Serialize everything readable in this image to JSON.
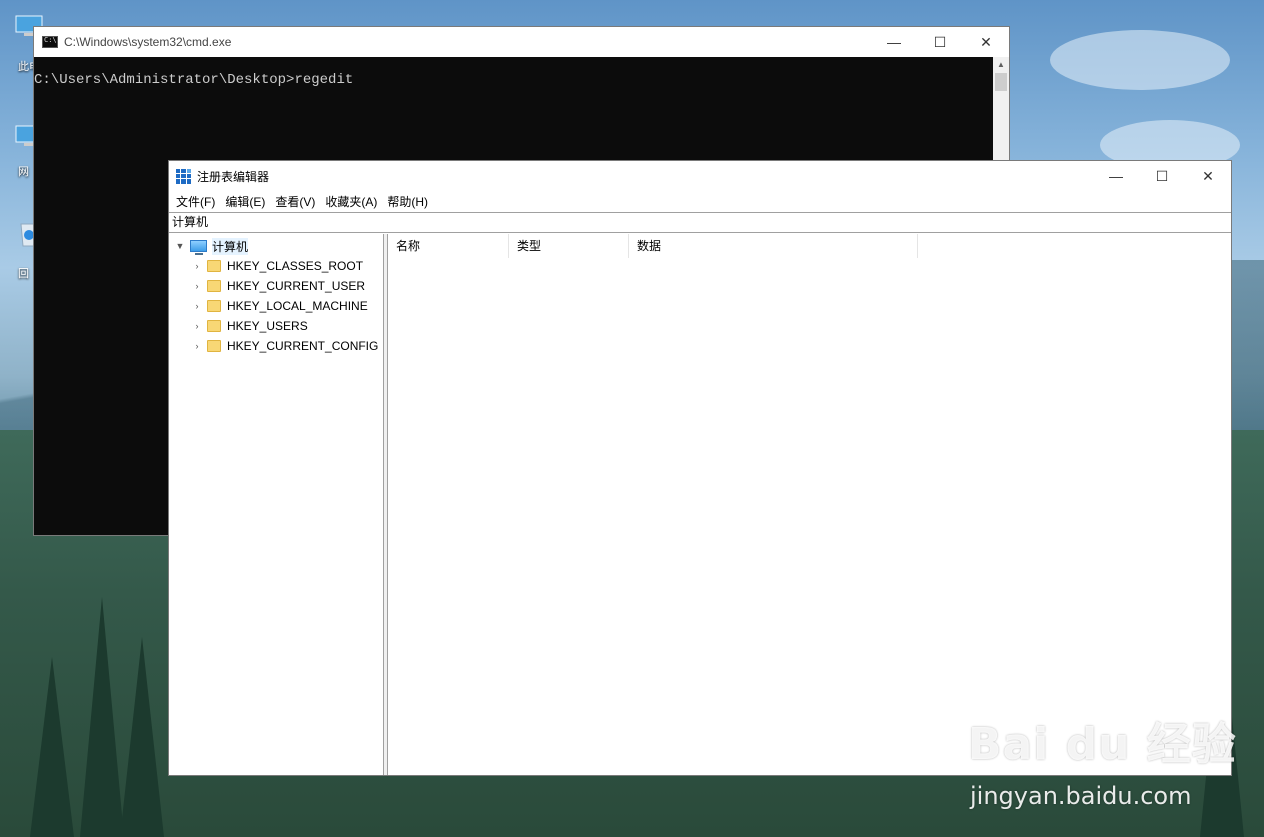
{
  "desktop": {
    "icons": [
      {
        "label": "此电",
        "icon": "this-pc-icon"
      },
      {
        "label": "网",
        "icon": "network-icon"
      },
      {
        "label": "回",
        "icon": "recycle-bin-icon"
      }
    ]
  },
  "cmd": {
    "title": "C:\\Windows\\system32\\cmd.exe",
    "prompt_line": "C:\\Users\\Administrator\\Desktop>regedit",
    "controls": {
      "minimize": "—",
      "maximize": "☐",
      "close": "✕"
    }
  },
  "regedit": {
    "title": "注册表编辑器",
    "controls": {
      "minimize": "—",
      "maximize": "☐",
      "close": "✕"
    },
    "menu": [
      "文件(F)",
      "编辑(E)",
      "查看(V)",
      "收藏夹(A)",
      "帮助(H)"
    ],
    "address": "计算机",
    "tree": {
      "root": "计算机",
      "children": [
        "HKEY_CLASSES_ROOT",
        "HKEY_CURRENT_USER",
        "HKEY_LOCAL_MACHINE",
        "HKEY_USERS",
        "HKEY_CURRENT_CONFIG"
      ]
    },
    "columns": [
      "名称",
      "类型",
      "数据"
    ]
  },
  "watermark": {
    "brand": "Bai du 经验",
    "url": "jingyan.baidu.com"
  }
}
